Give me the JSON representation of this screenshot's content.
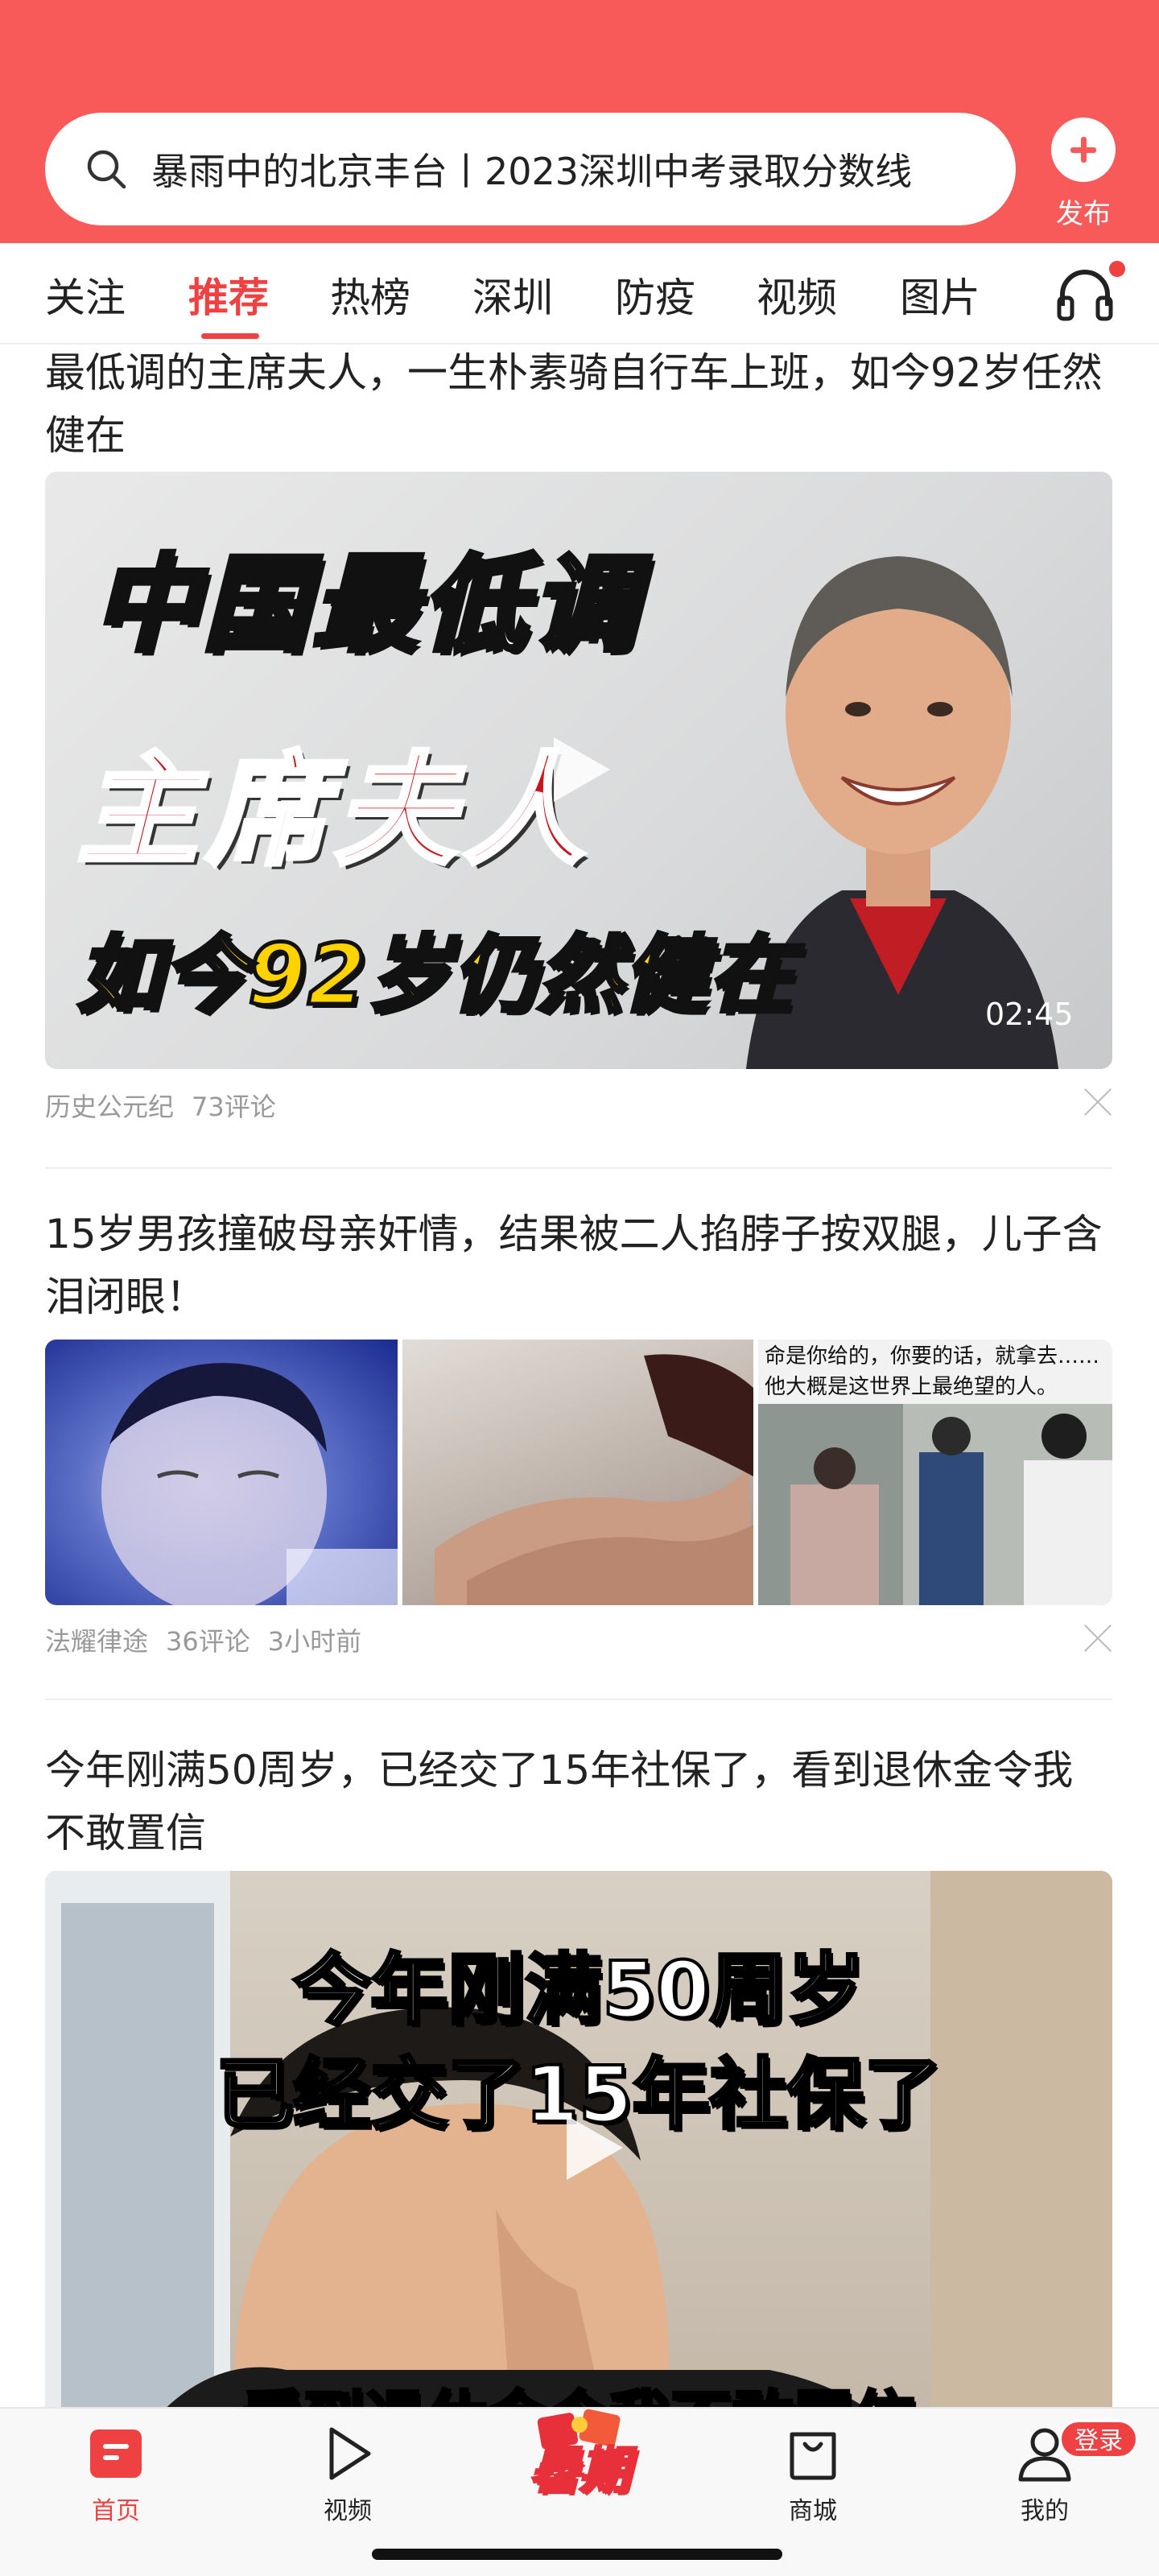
{
  "header": {
    "search_placeholder": "暴雨中的北京丰台丨2023深圳中考录取分数线",
    "publish_label": "发布",
    "search_icon": "search-icon",
    "publish_icon": "plus-circle-icon"
  },
  "tabs": [
    {
      "label": "关注",
      "active": false
    },
    {
      "label": "推荐",
      "active": true
    },
    {
      "label": "热榜",
      "active": false
    },
    {
      "label": "深圳",
      "active": false
    },
    {
      "label": "防疫",
      "active": false
    },
    {
      "label": "视频",
      "active": false
    },
    {
      "label": "图片",
      "active": false
    }
  ],
  "tabs_extra_icon": "headphone-icon",
  "feed": [
    {
      "title": "最低调的主席夫人，一生朴素骑自行车上班，如今92岁任然健在",
      "image_caption_lines": [
        "中国最低调",
        "主席夫人",
        "如今92岁仍然健在"
      ],
      "duration": "02:45",
      "source": "历史公元纪",
      "comments": "73评论"
    },
    {
      "title": "15岁男孩撞破母亲奸情，结果被二人掐脖子按双腿，儿子含泪闭眼！",
      "thumb3_caption": [
        "命是你给的，你要的话，就拿去……",
        "他大概是这世界上最绝望的人。"
      ],
      "source": "法耀律途",
      "comments": "36评论",
      "time": "3小时前"
    },
    {
      "title": "今年刚满50周岁，已经交了15年社保了，看到退休金令我不敢置信",
      "image_caption_lines": [
        "今年刚满50周岁",
        "已经交了15年社保了",
        "看到退休金令我不敢置信"
      ]
    }
  ],
  "bottom_nav": {
    "items": [
      {
        "label": "首页",
        "icon": "home-icon",
        "active": true
      },
      {
        "label": "视频",
        "icon": "play-icon",
        "active": false
      },
      {
        "label": "暑期",
        "icon": "summer-campaign-icon",
        "active": false
      },
      {
        "label": "商城",
        "icon": "shopping-bag-icon",
        "active": false
      },
      {
        "label": "我的",
        "icon": "user-icon",
        "active": false
      }
    ],
    "login_badge": "登录"
  },
  "colors": {
    "brand_red": "#f85959",
    "active_red": "#f04142",
    "meta_gray": "#999999"
  }
}
